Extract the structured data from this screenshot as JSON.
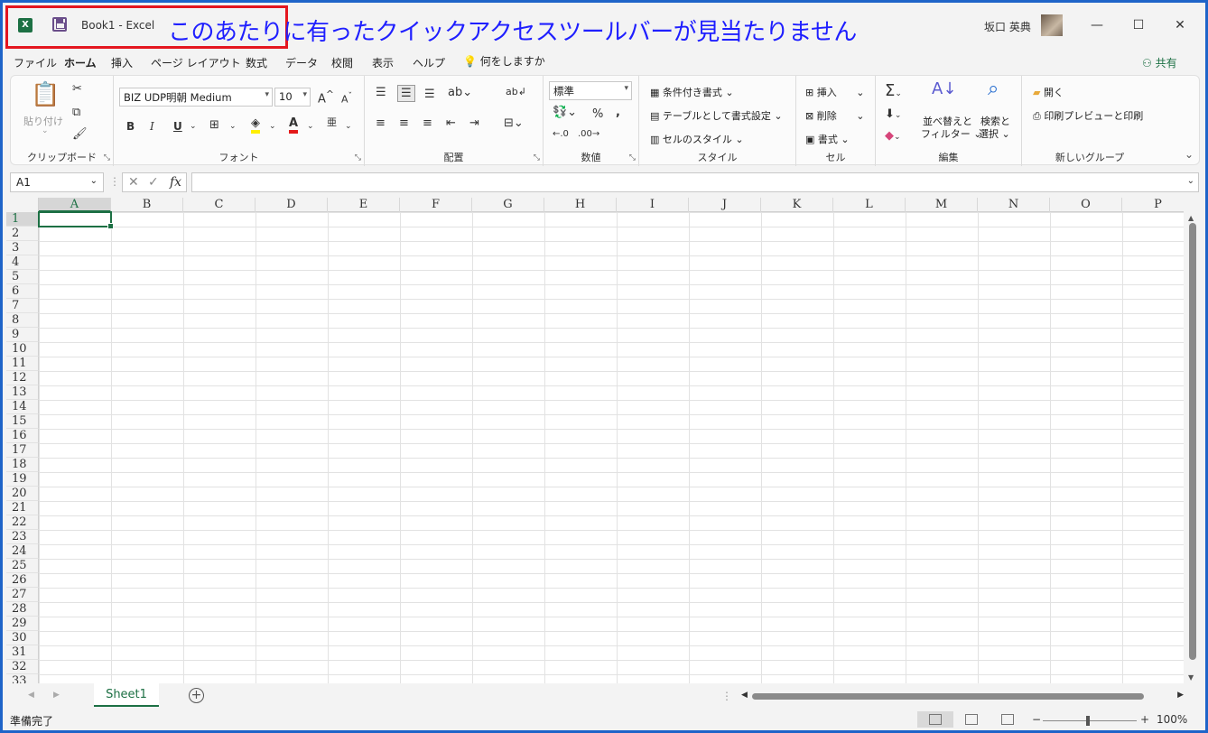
{
  "titlebar": {
    "app_icon": "X",
    "title": "Book1  -  Excel",
    "annotation": "このあたりに有ったクイックアクセスツールバーが見当たりません",
    "user": "坂口 英典",
    "minimize": "—",
    "maximize": "☐",
    "close": "✕"
  },
  "menu": {
    "items": [
      "ファイル",
      "ホーム",
      "挿入",
      "ページ レイアウト",
      "数式",
      "データ",
      "校閲",
      "表示",
      "ヘルプ"
    ],
    "tellme": "何をしますか",
    "share": "共有"
  },
  "ribbon": {
    "clipboard": {
      "label": "クリップボード",
      "paste": "貼り付け"
    },
    "font": {
      "label": "フォント",
      "font_name": "BIZ UDP明朝 Medium",
      "font_size": "10",
      "bold": "B",
      "italic": "I",
      "underline": "U"
    },
    "alignment": {
      "label": "配置"
    },
    "number": {
      "label": "数値",
      "format": "標準",
      "percent": "%",
      "comma": ","
    },
    "styles": {
      "label": "スタイル",
      "conditional": "条件付き書式",
      "table": "テーブルとして書式設定",
      "cell_styles": "セルのスタイル"
    },
    "cells": {
      "label": "セル",
      "insert": "挿入",
      "delete": "削除",
      "format": "書式"
    },
    "editing": {
      "label": "編集",
      "sort_filter_1": "並べ替えと",
      "sort_filter_2": "フィルター",
      "find_1": "検索と",
      "find_2": "選択"
    },
    "new_group": {
      "label": "新しいグループ",
      "open": "開く",
      "print_preview": "印刷プレビューと印刷"
    }
  },
  "formula_bar": {
    "name_box": "A1",
    "fx": "fx",
    "value": ""
  },
  "grid": {
    "columns": [
      "A",
      "B",
      "C",
      "D",
      "E",
      "F",
      "G",
      "H",
      "I",
      "J",
      "K",
      "L",
      "M",
      "N",
      "O",
      "P"
    ],
    "rows": [
      "1",
      "2",
      "3",
      "4",
      "5",
      "6",
      "7",
      "8",
      "9",
      "10",
      "11",
      "12",
      "13",
      "14",
      "15",
      "16",
      "17",
      "18",
      "19",
      "20",
      "21",
      "22",
      "23",
      "24",
      "25",
      "26",
      "27",
      "28",
      "29",
      "30",
      "31",
      "32",
      "33"
    ],
    "active_cell": "A1"
  },
  "sheets": {
    "tabs": [
      "Sheet1"
    ],
    "add": "+"
  },
  "status": {
    "text": "準備完了",
    "zoom_minus": "−",
    "zoom_plus": "+",
    "zoom": "100%"
  },
  "colors": {
    "accent": "#1d7044",
    "annotation": "#1f1fff",
    "highlight_box": "#e4161f"
  }
}
